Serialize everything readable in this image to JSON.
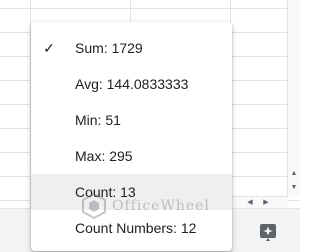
{
  "menu": {
    "items": [
      {
        "label": "Sum: 1729",
        "checked": true
      },
      {
        "label": "Avg: 144.0833333",
        "checked": false
      },
      {
        "label": "Min: 51",
        "checked": false
      },
      {
        "label": "Max: 295",
        "checked": false
      },
      {
        "label": "Count: 13",
        "checked": false,
        "highlighted": true
      },
      {
        "label": "Count Numbers: 12",
        "checked": false
      }
    ],
    "check_glyph": "✓"
  },
  "watermark": {
    "text": "OfficeWheel",
    "icon": "officewheel-logo"
  },
  "bottom_bar": {
    "explore_icon": "explore-sparkle-icon"
  },
  "colors": {
    "menu_bg": "#ffffff",
    "highlight": "#eeeff0",
    "text": "#202124",
    "bottom_bar": "#f1f3f4"
  }
}
